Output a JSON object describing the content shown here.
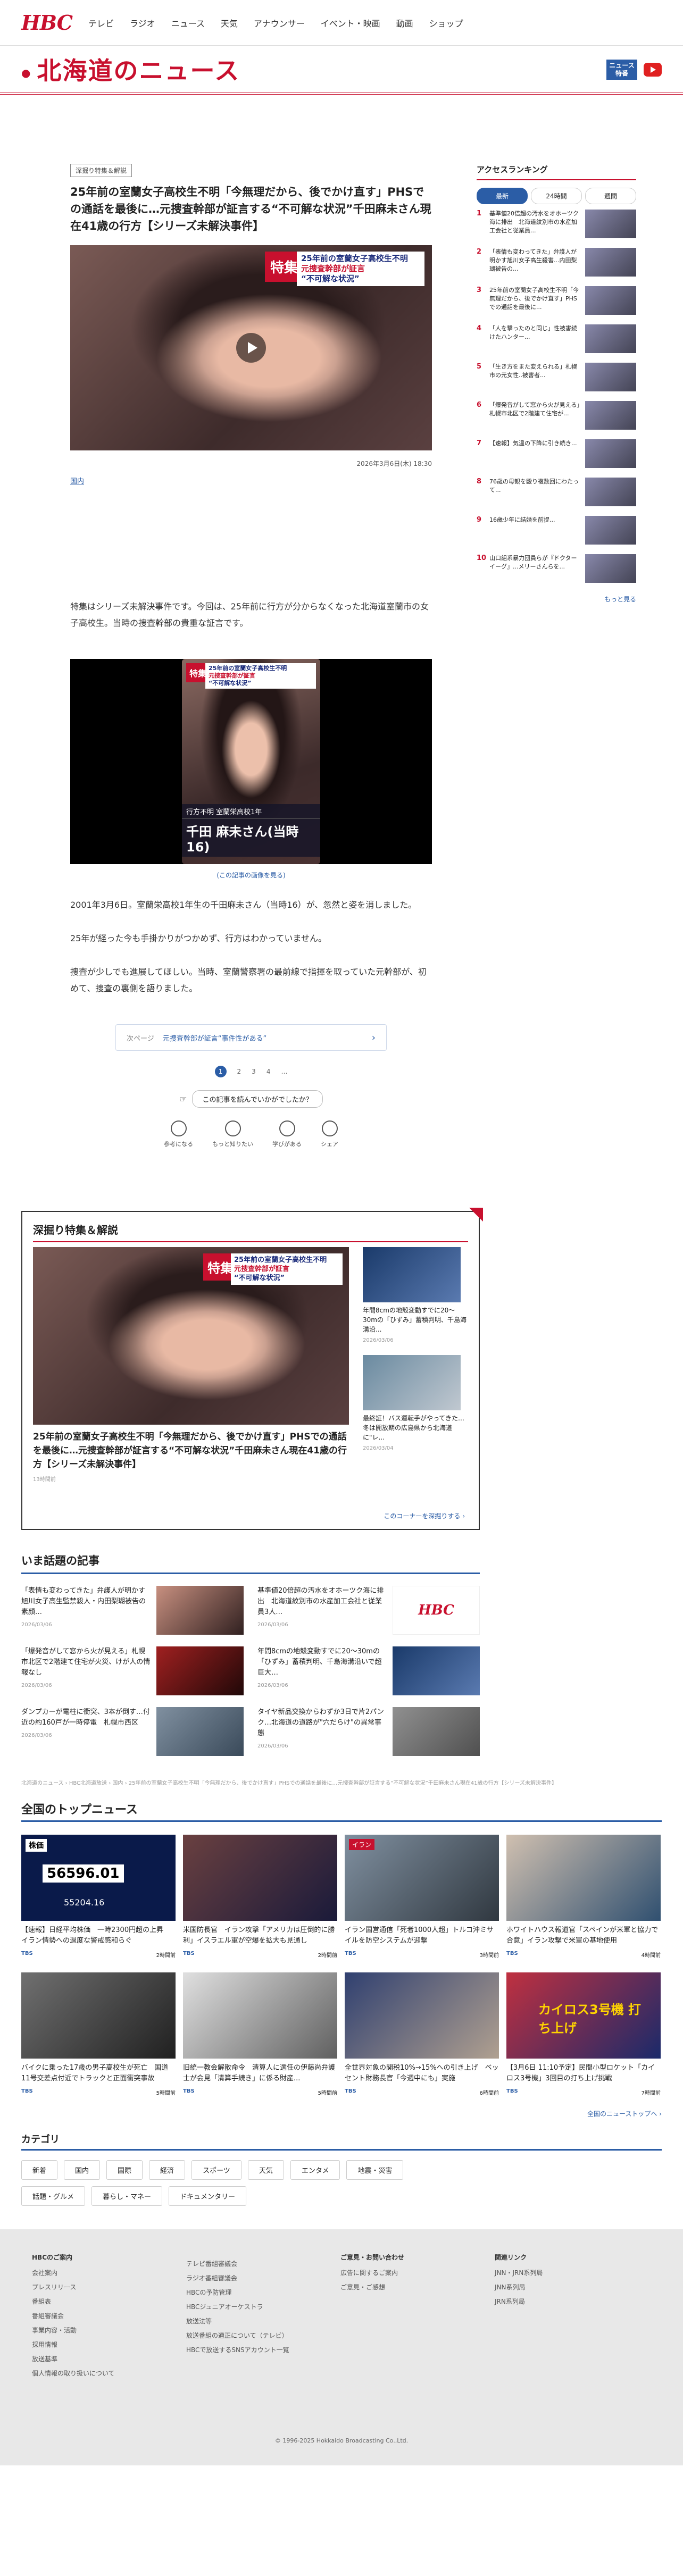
{
  "nav": {
    "logo": "HBC",
    "items": [
      "テレビ",
      "ラジオ",
      "ニュース",
      "天気",
      "アナウンサー",
      "イベント・映画",
      "動画",
      "ショップ"
    ]
  },
  "section": {
    "title": "北海道のニュース",
    "news_badge": "ニュース 特番",
    "youtube_label": "YouTube"
  },
  "article": {
    "tag": "深掘り特集＆解説",
    "headline": "25年前の室蘭女子高校生不明「今無理だから、後でかけ直す」PHSでの通話を最後に…元捜査幹部が証言する“不可解な状況”千田麻未さん現在41歳の行方【シリーズ未解決事件】",
    "overlay_label": "特集",
    "overlay_line1": "25年前の室蘭女子高校生不明",
    "overlay_line2": "元捜査幹部が証言",
    "overlay_line3": "“不可解な状況”",
    "date": "2026年3月6日(木) 18:30",
    "author": "国内",
    "p1": "特集はシリーズ未解決事件です。今回は、25年前に行方が分からなくなった北海道室蘭市の女子高校生。当時の捜査幹部の貴重な証言です。",
    "img2_small": "行方不明  室蘭栄高校1年",
    "img2_big": "千田 麻未さん(当時16)",
    "img_note": "(この記事の画像を見る)",
    "p2": "2001年3月6日。室蘭栄高校1年生の千田麻未さん（当時16）が、忽然と姿を消しました。",
    "p3": "25年が経った今も手掛かりがつかめず、行方はわかっていません。",
    "p4": "捜査が少しでも進展してほしい。当時、室蘭警察署の最前線で指揮を取っていた元幹部が、初めて、捜査の裏側を語りました。",
    "next_label": "次ページ",
    "next_title": "元捜査幹部が証言“事件性がある”",
    "pages": [
      "1",
      "2",
      "3",
      "4",
      "…"
    ],
    "feedback_q": "この記事を読んでいかがでしたか？",
    "reactions": [
      "参考になる",
      "もっと知りたい",
      "学びがある",
      "シェア"
    ]
  },
  "ranking": {
    "title": "アクセスランキング",
    "tabs": [
      "最新",
      "24時間",
      "週間"
    ],
    "items": [
      "基準値20倍超の汚水をオホーツク海に排出　北海道紋別市の水産加工会社と従業員...",
      "「表情も変わってきた」弁護人が明かす旭川女子高生殺害...内田梨瑚被告の...",
      "25年前の室蘭女子高校生不明「今無理だから、後でかけ直す」PHSでの通話を最後に...",
      "「人を撃ったのと同じ」性被害続けたハンター...",
      "「生き方をまた変えられる」札幌市の元女性..被害者...",
      "「爆発音がして窓から火が見える」札幌市北区で2階建て住宅が...",
      "【速報】気温の下降に引き続き...",
      "76歳の母親を殴り複数回にわたって...",
      "16歳少年に結婚を前提...",
      "山口組系暴力団員らが『ドクターイーグ』...メリーさんらを..."
    ],
    "more": "もっと見る"
  },
  "deep": {
    "title": "深掘り特集＆解説",
    "main_title": "25年前の室蘭女子高校生不明「今無理だから、後でかけ直す」PHSでの通話を最後に…元捜査幹部が証言する“不可解な状況”千田麻未さん現在41歳の行方【シリーズ未解決事件】",
    "main_date": "13時間前",
    "side": [
      {
        "title": "年間8cmの地殻変動すでに20～30mの「ひずみ」蓄積判明、千島海溝沿...",
        "date": "2026/03/06"
      },
      {
        "title": "最終証！バス運転手がやってきた…冬は開放期の広島県から北海道に\"レ...",
        "date": "2026/03/04"
      }
    ],
    "link": "このコーナーを深掘りする"
  },
  "topics": {
    "title": "いま話題の記事",
    "items": [
      {
        "title": "「表情も変わってきた」弁護人が明かす旭川女子高生監禁殺人・内田梨瑚被告の素顔…",
        "date": "2026/03/06"
      },
      {
        "title": "基準値20倍超の汚水をオホーツク海に排出　北海道紋別市の水産加工会社と従業員3人…",
        "date": "2026/03/06"
      },
      {
        "title": "「爆発音がして窓から火が見える」札幌市北区で2階建て住宅が火災、けが人の情報なし",
        "date": "2026/03/06"
      },
      {
        "title": "年間8cmの地殻変動すでに20～30mの「ひずみ」蓄積判明、千島海溝沿いで超巨大…",
        "date": "2026/03/06"
      },
      {
        "title": "ダンプカーが電柱に衝突、3本が倒す…付近の約160戸が一時停電　札幌市西区",
        "date": "2026/03/06"
      },
      {
        "title": "タイヤ新品交換からわずか3日で片2パンク…北海道の道路が\"穴だらけ\"の異常事態",
        "date": "2026/03/06"
      }
    ]
  },
  "breadcrumb": "北海道のニュース ›  HBC北海道放送  ›  国内  ›  25年前の室蘭女子高校生不明「今無理だから、後でかけ直す」PHSでの通話を最後に…元捜査幹部が証言する“不可解な状況”千田麻未さん現在41歳の行方【シリーズ未解決事件】",
  "national": {
    "title": "全国のトップニュース",
    "items": [
      {
        "title": "【速報】日経平均株価　一時2300円超の上昇　イラン情勢への過度な警戒感和らぐ",
        "src": "TBS",
        "time": "2時間前"
      },
      {
        "title": "米国防長官　イラン攻撃「アメリカは圧倒的に勝利」イスラエル軍が空爆を拡大も見通し",
        "src": "TBS",
        "time": "2時間前"
      },
      {
        "title": "イラン国営通信「死者1000人超」トルコ沖ミサイルを防空システムが迎撃",
        "src": "TBS",
        "time": "3時間前"
      },
      {
        "title": "ホワイトハウス報道官「スペインが米軍と協力で合意」イラン攻撃で米軍の基地使用",
        "src": "TBS",
        "time": "4時間前"
      },
      {
        "title": "バイクに乗った17歳の男子高校生が死亡　国道11号交差点付近でトラックと正面衝突事故",
        "src": "TBS",
        "time": "5時間前"
      },
      {
        "title": "旧統一教会解散命令　清算人に選任の伊藤尚弁護士が会見「清算手続き」に係る財産...",
        "src": "TBS",
        "time": "5時間前"
      },
      {
        "title": "全世界対象の関税10%→15%への引き上げ　ベッセント財務長官「今週中にも」実施",
        "src": "TBS",
        "time": "6時間前"
      },
      {
        "title": "【3月6日 11:10予定】民間小型ロケット「カイロス3号機」3回目の打ち上げ挑戦",
        "src": "TBS",
        "time": "7時間前"
      }
    ],
    "thumb_labels": [
      "株価",
      "56596.01",
      "55204.16",
      "イラン",
      "カイロス3号機 打ち上げ"
    ],
    "more": "全国のニューストップへ"
  },
  "category": {
    "title": "カテゴリ",
    "chips": [
      "新着",
      "国内",
      "国際",
      "経済",
      "スポーツ",
      "天気",
      "エンタメ",
      "地震・災害",
      "話題・グルメ",
      "暮らし・マネー",
      "ドキュメンタリー"
    ]
  },
  "footer": {
    "cols": [
      {
        "head": "HBCのご案内",
        "items": [
          "会社案内",
          "プレスリリース",
          "番組表",
          "番組審議会",
          "事業内容・活動",
          "採用情報",
          "放送基準",
          "個人情報の取り扱いについて"
        ]
      },
      {
        "head": " ",
        "items": [
          "テレビ番組審議会",
          "ラジオ番組審議会",
          "HBCの予防管理",
          "HBCジュニアオーケストラ",
          "放送法等",
          "放送番組の適正について（テレビ）",
          "HBCで放送するSNSアカウント一覧"
        ]
      },
      {
        "head": "ご意見・お問い合わせ",
        "items": [
          "広告に関するご案内",
          "ご意見・ご感想"
        ]
      },
      {
        "head": "関連リンク",
        "items": [
          "JNN・JRN系列局",
          "JNN系列局",
          "JRN系列局"
        ]
      }
    ],
    "copyright": "© 1996-2025 Hokkaido Broadcasting Co.,Ltd."
  }
}
